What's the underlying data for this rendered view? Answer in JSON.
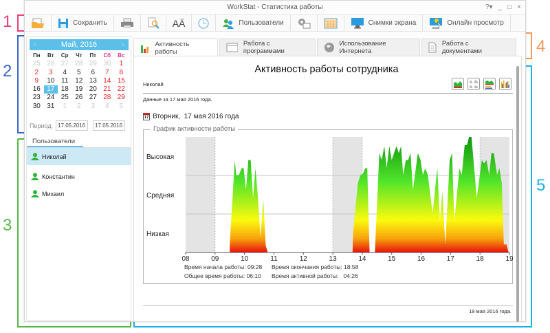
{
  "window": {
    "title": "WorkStat - Статистика работы",
    "controls": [
      "?▾",
      "_",
      "□",
      "×"
    ]
  },
  "toolbar": {
    "items": [
      {
        "icon": "open-folder-icon",
        "label": ""
      },
      {
        "icon": "save-icon",
        "label": "Сохранить"
      },
      {
        "icon": "print-icon",
        "label": ""
      },
      {
        "icon": "preview-icon",
        "label": ""
      },
      {
        "icon": "font-icon",
        "label": ""
      },
      {
        "icon": "clock-icon",
        "label": ""
      },
      {
        "icon": "users-icon",
        "label": "Пользователи"
      },
      {
        "icon": "settings-icon",
        "label": ""
      },
      {
        "icon": "calendar-grid-icon",
        "label": ""
      },
      {
        "icon": "monitor-icon",
        "label": "Снимки экрана"
      },
      {
        "icon": "monitor-live-icon",
        "label": "Онлайн просмотр"
      }
    ]
  },
  "calendar": {
    "month": "Май, 2016",
    "weekdays": [
      "Пн",
      "Вт",
      "Ср",
      "Чт",
      "Пт",
      "Сб",
      "Вс"
    ],
    "weeks": [
      [
        "25",
        "26",
        "27",
        "28",
        "29",
        "30",
        "1"
      ],
      [
        "2",
        "3",
        "4",
        "5",
        "6",
        "7",
        "8"
      ],
      [
        "9",
        "10",
        "11",
        "12",
        "13",
        "14",
        "15"
      ],
      [
        "16",
        "17",
        "18",
        "19",
        "20",
        "21",
        "22"
      ],
      [
        "23",
        "24",
        "25",
        "26",
        "27",
        "28",
        "29"
      ],
      [
        "30",
        "31",
        "1",
        "2",
        "3",
        "4",
        "5"
      ]
    ],
    "selected": "17",
    "period_label": "Период:",
    "period_from": "17.05.2016",
    "period_to": "17.05.2016"
  },
  "users": {
    "tab_label": "Пользователи",
    "items": [
      "Николай",
      "Константин",
      "Михаил"
    ],
    "selected": "Николай"
  },
  "tabs": [
    {
      "label": "Активность работы",
      "active": true
    },
    {
      "label": "Работа с программами"
    },
    {
      "label": "Использование Интернета"
    },
    {
      "label": "Работа с документами"
    }
  ],
  "report": {
    "title": "Активность работы сотрудника",
    "user": "Николай",
    "data_for": "Данные за 17 мая 2016 года.",
    "date_line": "Вторник,  17 мая 2016 года",
    "calendar_icon_day": "17",
    "group_label": "График активности работы",
    "stats": {
      "start_label": "Время начала работы:",
      "start": "09:28",
      "end_label": "Время окончания работы:",
      "end": "18:58",
      "total_label": "Общее время работы:",
      "total": "06:10",
      "active_label": "Время активной работы:",
      "active": "04:26"
    },
    "footer_date": "19 мая 2016 года."
  },
  "annotations": [
    {
      "n": "1",
      "color": "#e8407a"
    },
    {
      "n": "2",
      "color": "#3a64c8"
    },
    {
      "n": "3",
      "color": "#55b848"
    },
    {
      "n": "4",
      "color": "#f39a5c"
    },
    {
      "n": "5",
      "color": "#1cb0e6"
    }
  ],
  "chart_data": {
    "type": "area",
    "xlabel": "",
    "ylabel": "",
    "x_ticks": [
      "08",
      "09",
      "10",
      "11",
      "12",
      "13",
      "14",
      "15",
      "16",
      "17",
      "18",
      "19"
    ],
    "xlim": [
      8,
      19
    ],
    "y_levels": [
      "Низкая",
      "Средняя",
      "Высокая"
    ],
    "ylim": [
      0,
      100
    ],
    "non_working_bands": [
      [
        8,
        9
      ],
      [
        13,
        14
      ],
      [
        18,
        19
      ]
    ],
    "segments": [
      [
        [
          9.5,
          0
        ],
        [
          9.5,
          7
        ],
        [
          9.67,
          80
        ],
        [
          9.72,
          67
        ],
        [
          9.81,
          67
        ],
        [
          9.9,
          73
        ],
        [
          9.97,
          73
        ],
        [
          10.05,
          54
        ],
        [
          10.13,
          80
        ],
        [
          10.21,
          80
        ],
        [
          10.29,
          47
        ],
        [
          10.37,
          73
        ],
        [
          10.46,
          47
        ],
        [
          10.54,
          13
        ],
        [
          10.64,
          46
        ],
        [
          10.72,
          6
        ],
        [
          10.79,
          0
        ]
      ],
      [
        [
          13.67,
          0
        ],
        [
          13.69,
          17
        ],
        [
          13.85,
          60
        ],
        [
          13.94,
          67
        ],
        [
          14.02,
          68
        ],
        [
          14.1,
          73
        ],
        [
          14.17,
          73
        ],
        [
          14.25,
          0
        ]
      ],
      [
        [
          14.43,
          0
        ],
        [
          14.58,
          86
        ],
        [
          14.66,
          80
        ],
        [
          14.75,
          92
        ],
        [
          14.83,
          73
        ],
        [
          14.92,
          92
        ],
        [
          15.0,
          80
        ],
        [
          15.16,
          92
        ],
        [
          15.24,
          86
        ],
        [
          15.32,
          92
        ],
        [
          15.39,
          67
        ],
        [
          15.48,
          80
        ],
        [
          15.56,
          80
        ],
        [
          15.64,
          86
        ],
        [
          15.72,
          54
        ],
        [
          15.89,
          86
        ],
        [
          15.98,
          80
        ],
        [
          16.06,
          67
        ],
        [
          16.14,
          73
        ],
        [
          16.23,
          67
        ],
        [
          16.39,
          34
        ],
        [
          16.55,
          73
        ],
        [
          16.64,
          27
        ],
        [
          16.72,
          53
        ],
        [
          16.82,
          7
        ],
        [
          16.97,
          80
        ],
        [
          17.05,
          86
        ],
        [
          17.13,
          27
        ],
        [
          17.3,
          73
        ],
        [
          17.38,
          67
        ],
        [
          17.48,
          93
        ],
        [
          17.56,
          93
        ],
        [
          17.63,
          100
        ],
        [
          17.71,
          100
        ],
        [
          17.89,
          47
        ],
        [
          18.06,
          80
        ],
        [
          18.14,
          77
        ],
        [
          18.22,
          80
        ],
        [
          18.31,
          67
        ],
        [
          18.39,
          86
        ],
        [
          18.47,
          86
        ],
        [
          18.58,
          67
        ],
        [
          18.66,
          73
        ],
        [
          18.74,
          60
        ],
        [
          18.81,
          7
        ],
        [
          18.9,
          7
        ],
        [
          18.97,
          0
        ]
      ]
    ],
    "gradient_colors": [
      "#e8100c",
      "#f7a10b",
      "#fbfa0d",
      "#4fe42a",
      "#0f9410"
    ]
  }
}
